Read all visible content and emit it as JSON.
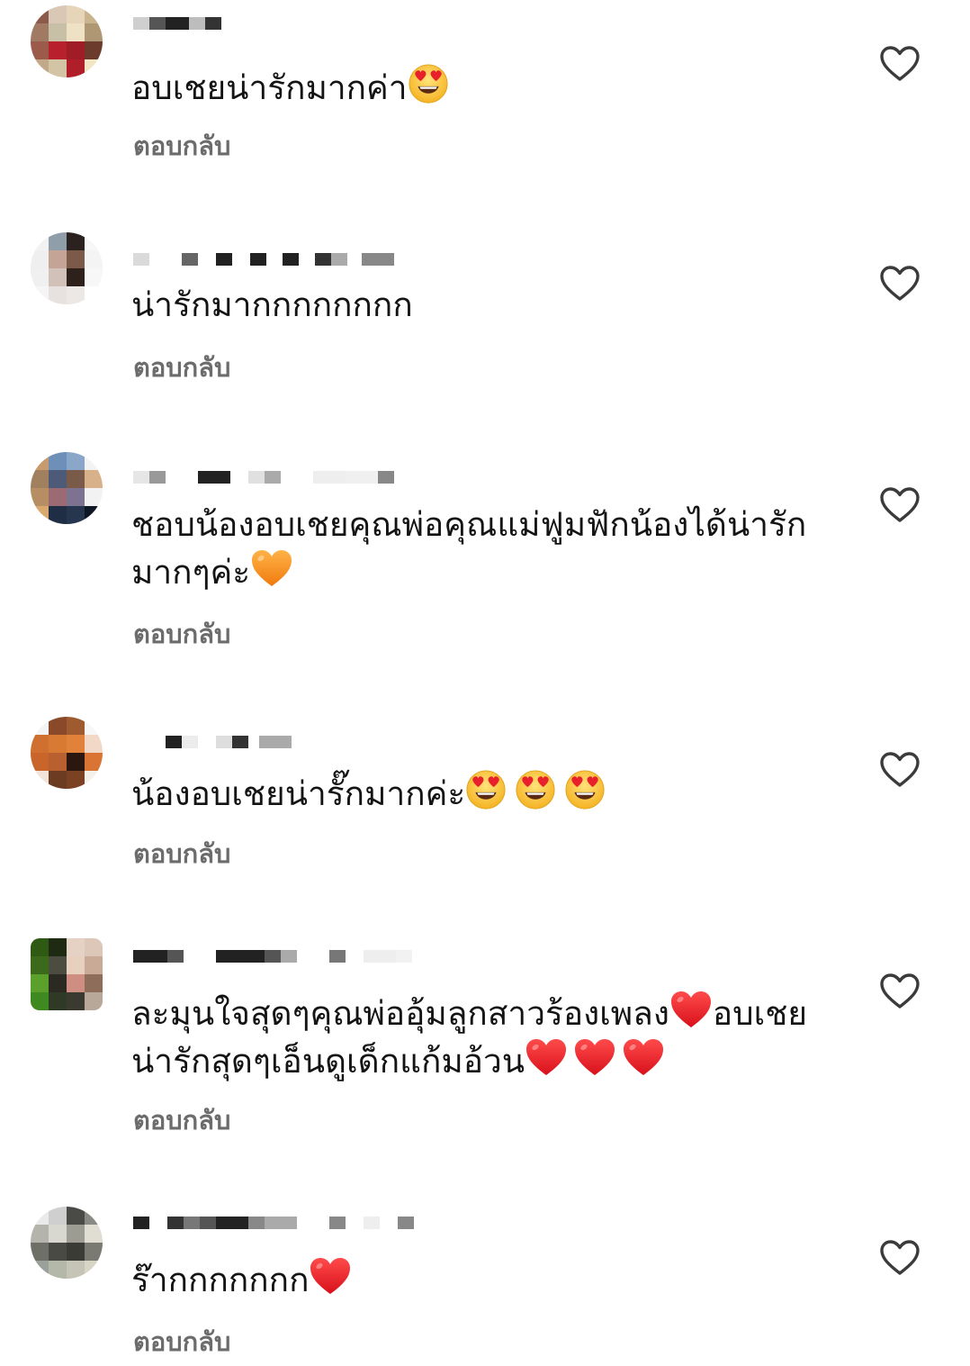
{
  "comments": [
    {
      "text": "อบเชยน่ารักมากค่า",
      "emojis": [
        "heart-eyes"
      ],
      "reply_label": "ตอบกลับ"
    },
    {
      "text": "น่ารักมากกกกกกกก",
      "emojis": [],
      "reply_label": "ตอบกลับ"
    },
    {
      "text": "ชอบน้องอบเชยคุณพ่อคุณแม่ฟูมฟักน้องได้น่ารักมากๆค่ะ",
      "emojis": [
        "orange-heart"
      ],
      "reply_label": "ตอบกลับ"
    },
    {
      "text": "น้องอบเชยน่ารั๊กมากค่ะ",
      "emojis": [
        "heart-eyes",
        "heart-eyes",
        "heart-eyes"
      ],
      "reply_label": "ตอบกลับ"
    },
    {
      "text_line1": "ละมุนใจสุดๆคุณพ่ออุ้มลูกสาวร้องเพลง",
      "text_line1_end": "อบเชย",
      "text_line2": "น่ารักสุดๆเอ็นดูเด็กแก้มอ้วน",
      "emojis": [
        "red-heart",
        "red-heart",
        "red-heart",
        "red-heart"
      ],
      "reply_label": "ตอบกลับ"
    },
    {
      "text": "ร๊ากกกกกกก",
      "emojis": [
        "red-heart"
      ],
      "reply_label": "ตอบกลับ"
    }
  ],
  "icons": {
    "like": "heart-outline-icon",
    "heart_eyes": "heart-eyes-emoji",
    "red_heart": "red-heart-emoji",
    "orange_heart": "orange-heart-emoji"
  },
  "colors": {
    "text": "#141414",
    "reply": "#6c6c6c",
    "like_outline": "#3b3b3b",
    "red_heart": "#e8202b",
    "orange_heart": "#f7901e",
    "emoji_face": "#fbc02d"
  }
}
